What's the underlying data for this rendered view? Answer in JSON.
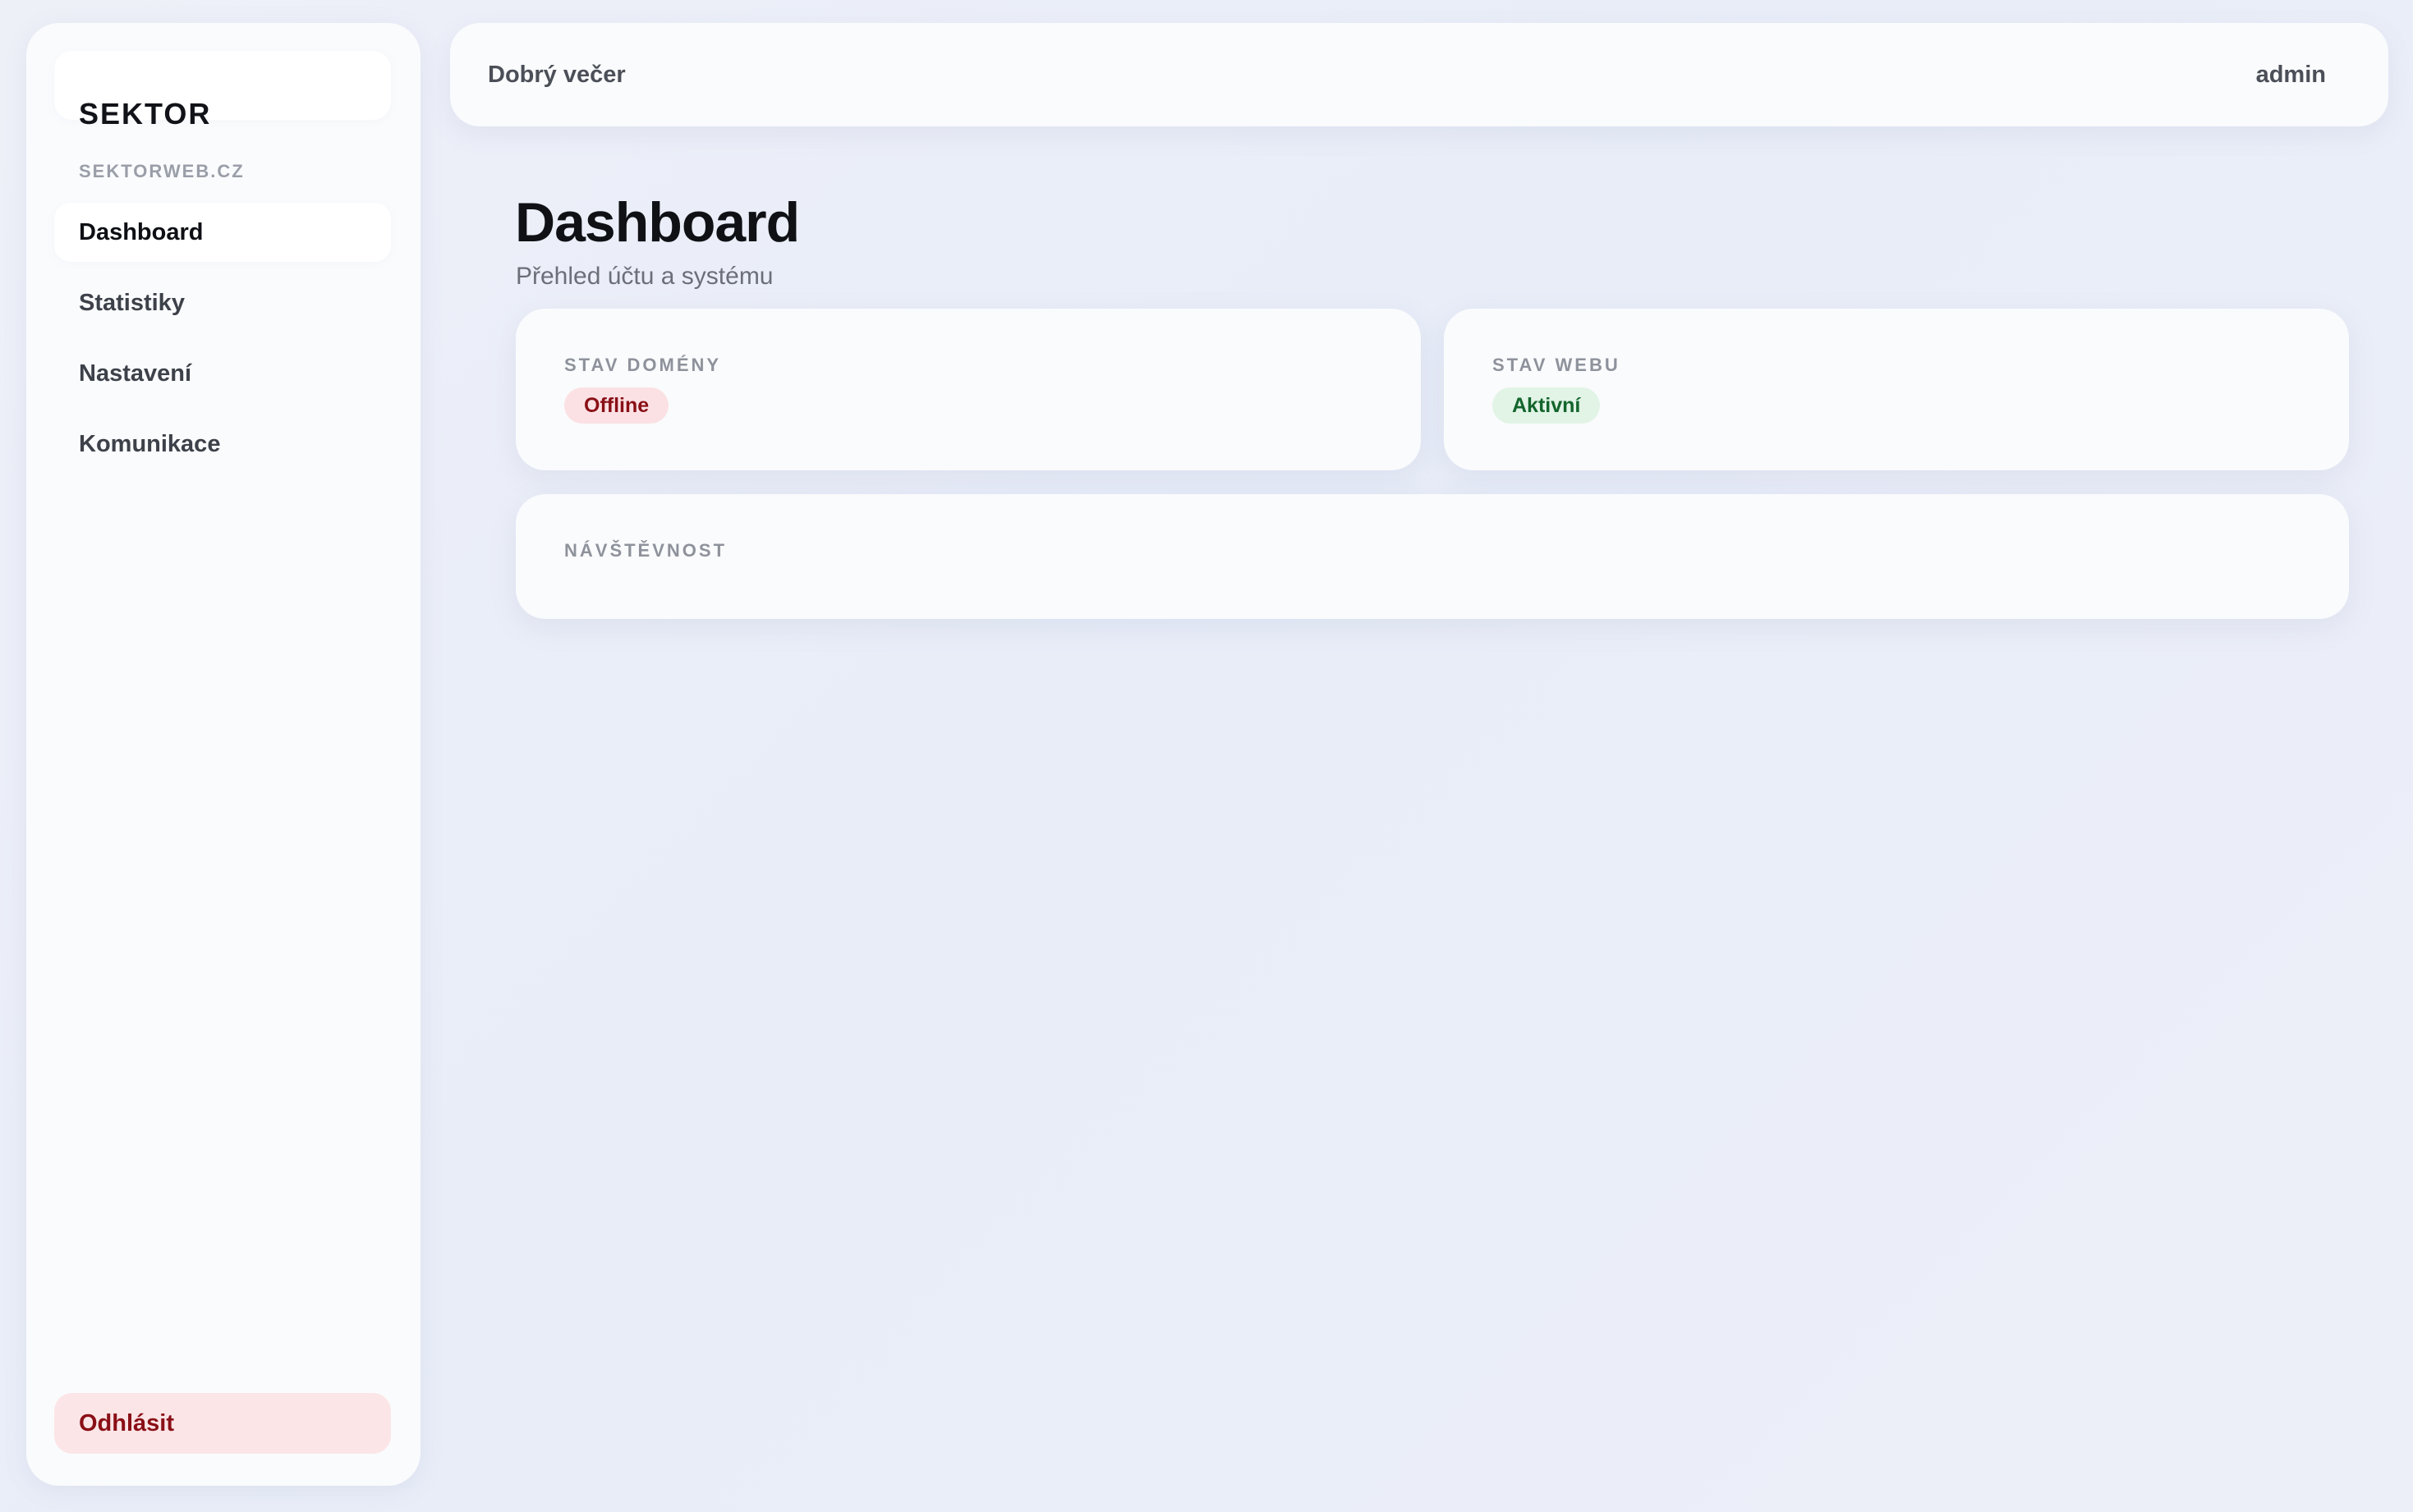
{
  "sidebar": {
    "brand_name": "SEKTOR",
    "brand_domain": "SEKTORWEB.CZ",
    "items": [
      {
        "label": "Dashboard",
        "active": true
      },
      {
        "label": "Statistiky",
        "active": false
      },
      {
        "label": "Nastavení",
        "active": false
      },
      {
        "label": "Komunikace",
        "active": false
      }
    ],
    "logout_label": "Odhlásit"
  },
  "header": {
    "greeting": "Dobrý večer",
    "user": "admin"
  },
  "main": {
    "title": "Dashboard",
    "subtitle": "Přehled účtu a systému",
    "cards": {
      "domain_status": {
        "label": "STAV DOMÉNY",
        "value": "Offline"
      },
      "web_status": {
        "label": "STAV WEBU",
        "value": "Aktivní"
      },
      "visits": {
        "label": "NÁVŠTĚVNOST"
      }
    }
  },
  "colors": {
    "offline_bg": "#fbe1e4",
    "offline_text": "#8a0f16",
    "active_bg": "#e1f4e6",
    "active_text": "#13652c",
    "logout_bg": "#fbe5e7"
  }
}
